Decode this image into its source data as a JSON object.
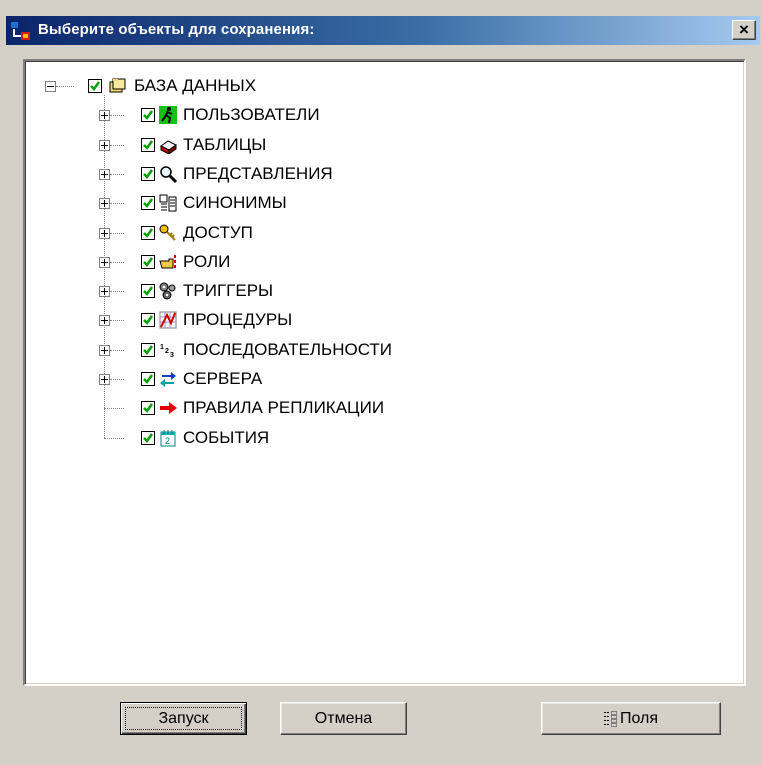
{
  "window": {
    "title": "Выберите объекты для сохранения:",
    "close_glyph": "×"
  },
  "tree": {
    "root": {
      "label": "БАЗА ДАННЫХ",
      "checked": true,
      "expanded": true,
      "icon": "database-folders-icon"
    },
    "items": [
      {
        "label": "ПОЛЬЗОВАТЕЛИ",
        "checked": true,
        "expandable": true,
        "icon": "running-user-icon"
      },
      {
        "label": "ТАБЛИЦЫ",
        "checked": true,
        "expandable": true,
        "icon": "table-stack-icon"
      },
      {
        "label": "ПРЕДСТАВЛЕНИЯ",
        "checked": true,
        "expandable": true,
        "icon": "magnifier-icon"
      },
      {
        "label": "СИНОНИМЫ",
        "checked": true,
        "expandable": true,
        "icon": "synonym-icon"
      },
      {
        "label": "ДОСТУП",
        "checked": true,
        "expandable": true,
        "icon": "key-icon"
      },
      {
        "label": "РОЛИ",
        "checked": true,
        "expandable": true,
        "icon": "pointing-hand-icon"
      },
      {
        "label": "ТРИГГЕРЫ",
        "checked": true,
        "expandable": true,
        "icon": "trigger-gears-icon"
      },
      {
        "label": "ПРОЦЕДУРЫ",
        "checked": true,
        "expandable": true,
        "icon": "procedure-chart-icon"
      },
      {
        "label": "ПОСЛЕДОВАТЕЛЬНОСТИ",
        "checked": true,
        "expandable": true,
        "icon": "sequence-123-icon"
      },
      {
        "label": "СЕРВЕРА",
        "checked": true,
        "expandable": true,
        "icon": "server-arrows-icon"
      },
      {
        "label": "ПРАВИЛА РЕПЛИКАЦИИ",
        "checked": true,
        "expandable": false,
        "icon": "red-arrow-icon"
      },
      {
        "label": "СОБЫТИЯ",
        "checked": true,
        "expandable": false,
        "icon": "calendar-icon"
      }
    ]
  },
  "buttons": {
    "run": "Запуск",
    "cancel": "Отмена",
    "fields": "Поля"
  },
  "colors": {
    "title_gradient_start": "#0a246a",
    "title_gradient_end": "#a6caf0",
    "dialog_face": "#d4d0c8",
    "check_green": "#00a000"
  }
}
